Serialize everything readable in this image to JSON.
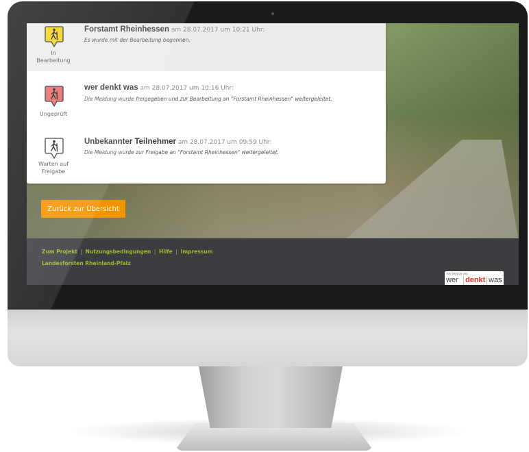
{
  "entries": [
    {
      "author": "Forstamt Rheinhessen",
      "meta": "am 28.07.2017 um 10:21 Uhr:",
      "message": "Es wurde mit der Bearbeitung begonnen.",
      "status_line1": "In",
      "status_line2": "Bearbeitung",
      "badge_color": "#f4d31c",
      "icon": "hiker-icon"
    },
    {
      "author": "wer denkt was",
      "meta": "am 28.07.2017 um 10:16 Uhr:",
      "message": "Die Meldung wurde freigegeben und zur Bearbeitung an \"Forstamt Rheinhessen\" weitergeleitet.",
      "status_line1": "Ungeprüft",
      "badge_color": "#e86a6a",
      "icon": "hiker-icon"
    },
    {
      "author": "Unbekannter Teilnehmer",
      "meta": "am 28.07.2017 um 09:59 Uhr:",
      "message": "Die Meldung wurde zur Freigabe an \"Forstamt Rheinhessen\" weitergeleitet.",
      "status_line1": "Warten auf",
      "status_line2": "Freigabe",
      "badge_color": "#ffffff",
      "icon": "hiker-icon"
    }
  ],
  "back_button": "Zurück zur Übersicht",
  "footer": {
    "links": [
      "Zum Projekt",
      "Nutzungsbedingungen",
      "Hilfe",
      "Impressum"
    ],
    "separator": "|",
    "org": "Landesforsten Rheinland-Pfalz",
    "logo_tagline": "ein Service von",
    "logo_words": [
      "wer",
      "denkt",
      "was"
    ]
  },
  "colors": {
    "accent_orange": "#f29400",
    "footer_bg": "#3c3d41",
    "footer_link": "#9bbb2f",
    "logo_red": "#e4342b"
  }
}
